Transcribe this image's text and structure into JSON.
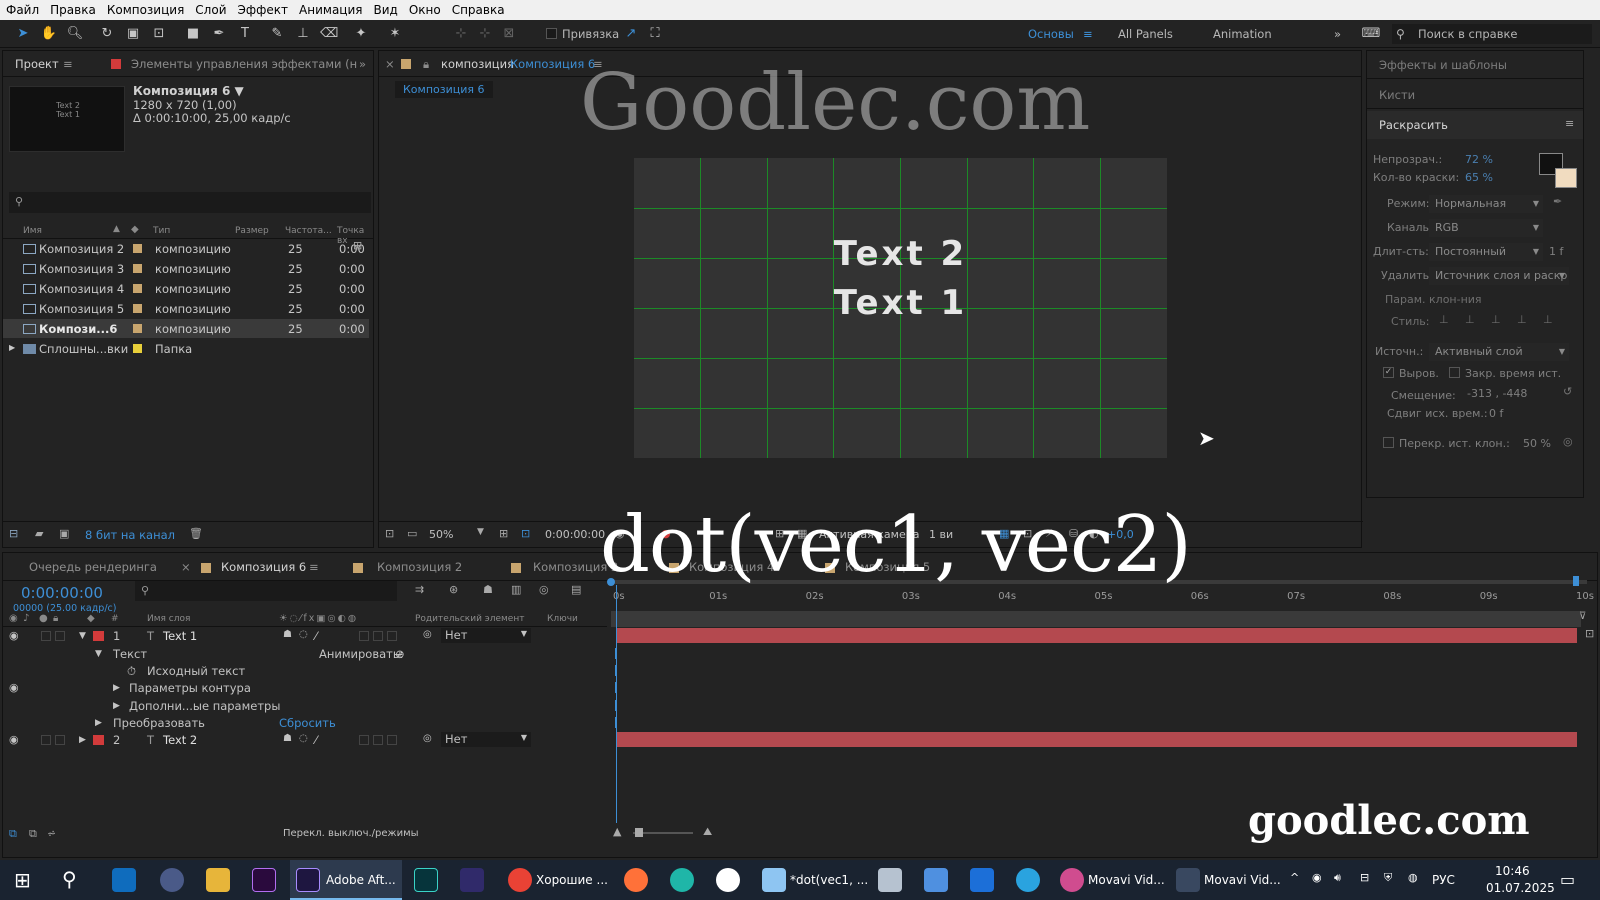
{
  "menu": [
    "Файл",
    "Правка",
    "Композиция",
    "Слой",
    "Эффект",
    "Анимация",
    "Вид",
    "Окно",
    "Справка"
  ],
  "toolbar": {
    "snapping": "Привязка",
    "workspaces": [
      "Основы",
      "All Panels",
      "Animation"
    ],
    "help_placeholder": "Поиск в справке"
  },
  "project": {
    "tabs": [
      "Проект",
      "Элементы управления эффектами (н"
    ],
    "comp_name": "Композиция 6 ▼",
    "comp_size": "1280 x 720 (1,00)",
    "comp_duration": "Δ 0:00:10:00, 25,00 кадр/с",
    "thumb_text": [
      "Text 2",
      "Text 1"
    ],
    "columns": [
      "Имя",
      "Тип",
      "Размер",
      "Частота...",
      "Точка вх"
    ],
    "items": [
      {
        "name": "Композиция 2",
        "type": "композицию",
        "fps": "25",
        "in": "0:00",
        "color": "#c8a56e"
      },
      {
        "name": "Композиция 3",
        "type": "композицию",
        "fps": "25",
        "in": "0:00",
        "color": "#c8a56e"
      },
      {
        "name": "Композиция 4",
        "type": "композицию",
        "fps": "25",
        "in": "0:00",
        "color": "#c8a56e"
      },
      {
        "name": "Композиция 5",
        "type": "композицию",
        "fps": "25",
        "in": "0:00",
        "color": "#c8a56e"
      },
      {
        "name": "Компози...6",
        "type": "композицию",
        "fps": "25",
        "in": "0:00",
        "color": "#c8a56e"
      },
      {
        "name": "Сплошны...вки",
        "type": "Папка",
        "fps": "",
        "in": "",
        "color": "#e8cf3a"
      }
    ],
    "bit_depth": "8 бит на канал"
  },
  "viewer": {
    "tab_label": "композиция",
    "tab_comp": "Композиция 6",
    "sub_tab": "Композиция 6",
    "canvas_lines": [
      "Text 2",
      "Text 1"
    ],
    "zoom": "50%",
    "time": "0:00:00:00",
    "camera": "Активная камера",
    "views": "1 ви",
    "offset": "+0,0"
  },
  "right_panel": {
    "effects": "Эффекты и шаблоны",
    "brushes": "Кисти",
    "paint": "Раскрасить",
    "opacity_lbl": "Непрозрач.:",
    "opacity_val": "72 %",
    "flow_lbl": "Кол-во краски:",
    "flow_val": "65 %",
    "mode_lbl": "Режим:",
    "mode_val": "Нормальная",
    "channels_lbl": "Каналы:",
    "channels_val": "RGB",
    "duration_lbl": "Длит-сть:",
    "duration_val": "Постоянный",
    "duration_f": "1 f",
    "erase_lbl": "Удалить:",
    "erase_val": "Источник слоя и раскр",
    "clone_params": "Парам. клон-ния",
    "style_lbl": "Стиль:",
    "source_lbl": "Источн.:",
    "source_val": "Активный слой",
    "aligned": "Выров.",
    "lock_time": "Закр. время ист.",
    "offset_lbl": "Смещение:",
    "offset_val": "-313 ,  -448",
    "shift_lbl": "Сдвиг исх. врем.:",
    "shift_val": "0 f",
    "overlay_lbl": "Перекр. ист. клон.:",
    "overlay_val": "50 %"
  },
  "timeline": {
    "tabs": [
      "Очередь рендеринга",
      "Композиция 6",
      "Композиция 2",
      "Композиция 3",
      "Композиция 4",
      "Композиция 5"
    ],
    "timecode": "0:00:00:00",
    "frames": "00000 (25.00 кадр/с)",
    "col_name": "Имя слоя",
    "col_parent": "Родительский элемент",
    "col_keys": "Ключи",
    "ruler": [
      "0s",
      "01s",
      "02s",
      "03s",
      "04s",
      "05s",
      "06s",
      "07s",
      "08s",
      "09s",
      "10s"
    ],
    "layers": [
      {
        "num": "1",
        "name": "Text 1",
        "parent": "Нет"
      },
      {
        "num": "2",
        "name": "Text 2",
        "parent": "Нет"
      }
    ],
    "props": {
      "text": "Текст",
      "animate": "Анимировать:",
      "source_text": "Исходный текст",
      "path_opts": "Параметры контура",
      "more_opts": "Дополни...ые параметры",
      "transform": "Преобразовать",
      "reset": "Сбросить"
    },
    "toggle_modes": "Перекл. выключ./режимы"
  },
  "watermarks": {
    "top": "Goodlec.com",
    "formula": "dot(vec1, vec2)",
    "bottom": "goodlec.com"
  },
  "taskbar": {
    "apps": [
      "Adobe Aft...",
      "Хорошие ...",
      "*dot(vec1, ...",
      "Movavi Vid...",
      "Movavi Vid..."
    ],
    "lang": "РУС",
    "time": "10:46",
    "date": "01.07.2025"
  },
  "colors": {
    "accent": "#3d8fd6",
    "layer_bar": "#b4494f",
    "label_red": "#d23b3b",
    "grid": "#1c8a27"
  }
}
